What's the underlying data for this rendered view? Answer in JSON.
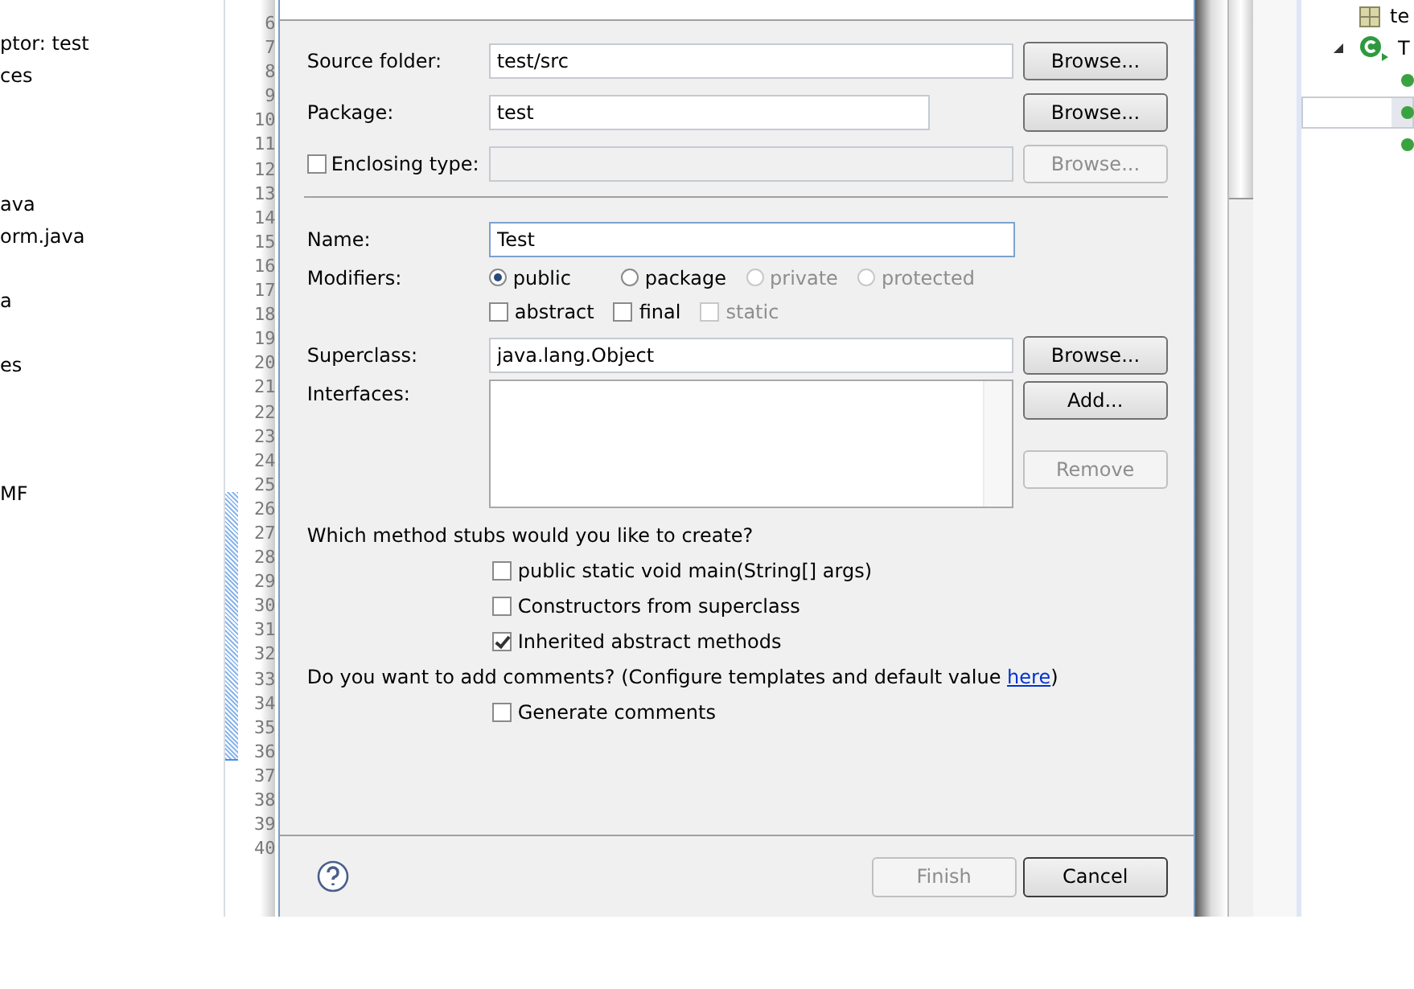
{
  "explorer": {
    "rows": [
      {
        "text": "ptor: test"
      },
      {
        "text": "ces"
      },
      {},
      {},
      {},
      {
        "text": "ava"
      },
      {
        "text": "orm.java"
      },
      {},
      {
        "text": "a"
      },
      {},
      {
        "text": "es"
      },
      {},
      {},
      {},
      {
        "text": "MF"
      }
    ]
  },
  "editor": {
    "line_numbers": [
      "6",
      "7",
      "8",
      "9",
      "10",
      "11",
      "12",
      "13",
      "14",
      "15",
      "16",
      "17",
      "18",
      "19",
      "20",
      "21",
      "22",
      "23",
      "24",
      "25",
      "26",
      "27",
      "28",
      "29",
      "30",
      "31",
      "32",
      "33",
      "34",
      "35",
      "36",
      "37",
      "38",
      "39",
      "40"
    ]
  },
  "dialog": {
    "source_folder": {
      "label": "Source folder:",
      "value": "test/src",
      "button": {
        "label": "Browse...",
        "disabled": false
      }
    },
    "package": {
      "label": "Package:",
      "value": "test",
      "button": {
        "label": "Browse...",
        "disabled": false
      }
    },
    "enclosing_type": {
      "label": "Enclosing type:",
      "checked": false,
      "button": {
        "label": "Browse...",
        "disabled": true
      }
    },
    "name": {
      "label": "Name:",
      "value": "Test"
    },
    "modifiers": {
      "label": "Modifiers:",
      "radios": [
        {
          "label": "public",
          "selected": true,
          "disabled": false
        },
        {
          "label": "package",
          "selected": false,
          "disabled": false
        },
        {
          "label": "private",
          "selected": false,
          "disabled": true
        },
        {
          "label": "protected",
          "selected": false,
          "disabled": true
        }
      ],
      "checks": [
        {
          "label": "abstract",
          "checked": false,
          "disabled": false
        },
        {
          "label": "final",
          "checked": false,
          "disabled": false
        },
        {
          "label": "static",
          "checked": false,
          "disabled": true
        }
      ]
    },
    "superclass": {
      "label": "Superclass:",
      "value": "java.lang.Object",
      "button": {
        "label": "Browse...",
        "disabled": false
      }
    },
    "interfaces": {
      "label": "Interfaces:",
      "buttons": [
        {
          "label": "Add...",
          "disabled": false
        },
        {
          "label": "Remove",
          "disabled": true
        }
      ]
    },
    "stubs": {
      "question": "Which method stubs would you like to create?",
      "options": [
        {
          "label": "public static void main(String[] args)",
          "checked": false
        },
        {
          "label": "Constructors from superclass",
          "checked": false
        },
        {
          "label": "Inherited abstract methods",
          "checked": true
        }
      ]
    },
    "comments": {
      "question": "Do you want to add comments? (Configure templates and default value ",
      "link": "here",
      "after": ")",
      "options": [
        {
          "label": "Generate comments",
          "checked": false
        }
      ]
    },
    "footer": {
      "buttons": [
        {
          "label": "Finish",
          "disabled": true
        },
        {
          "label": "Cancel",
          "disabled": false
        }
      ]
    }
  },
  "outline": {
    "items": [
      {
        "kind": "package",
        "text": "te",
        "selected": false
      },
      {
        "kind": "class",
        "text": "T",
        "selected": false
      },
      {
        "kind": "method",
        "selected": false
      },
      {
        "kind": "method",
        "selected": true
      },
      {
        "kind": "method",
        "selected": false
      }
    ]
  }
}
